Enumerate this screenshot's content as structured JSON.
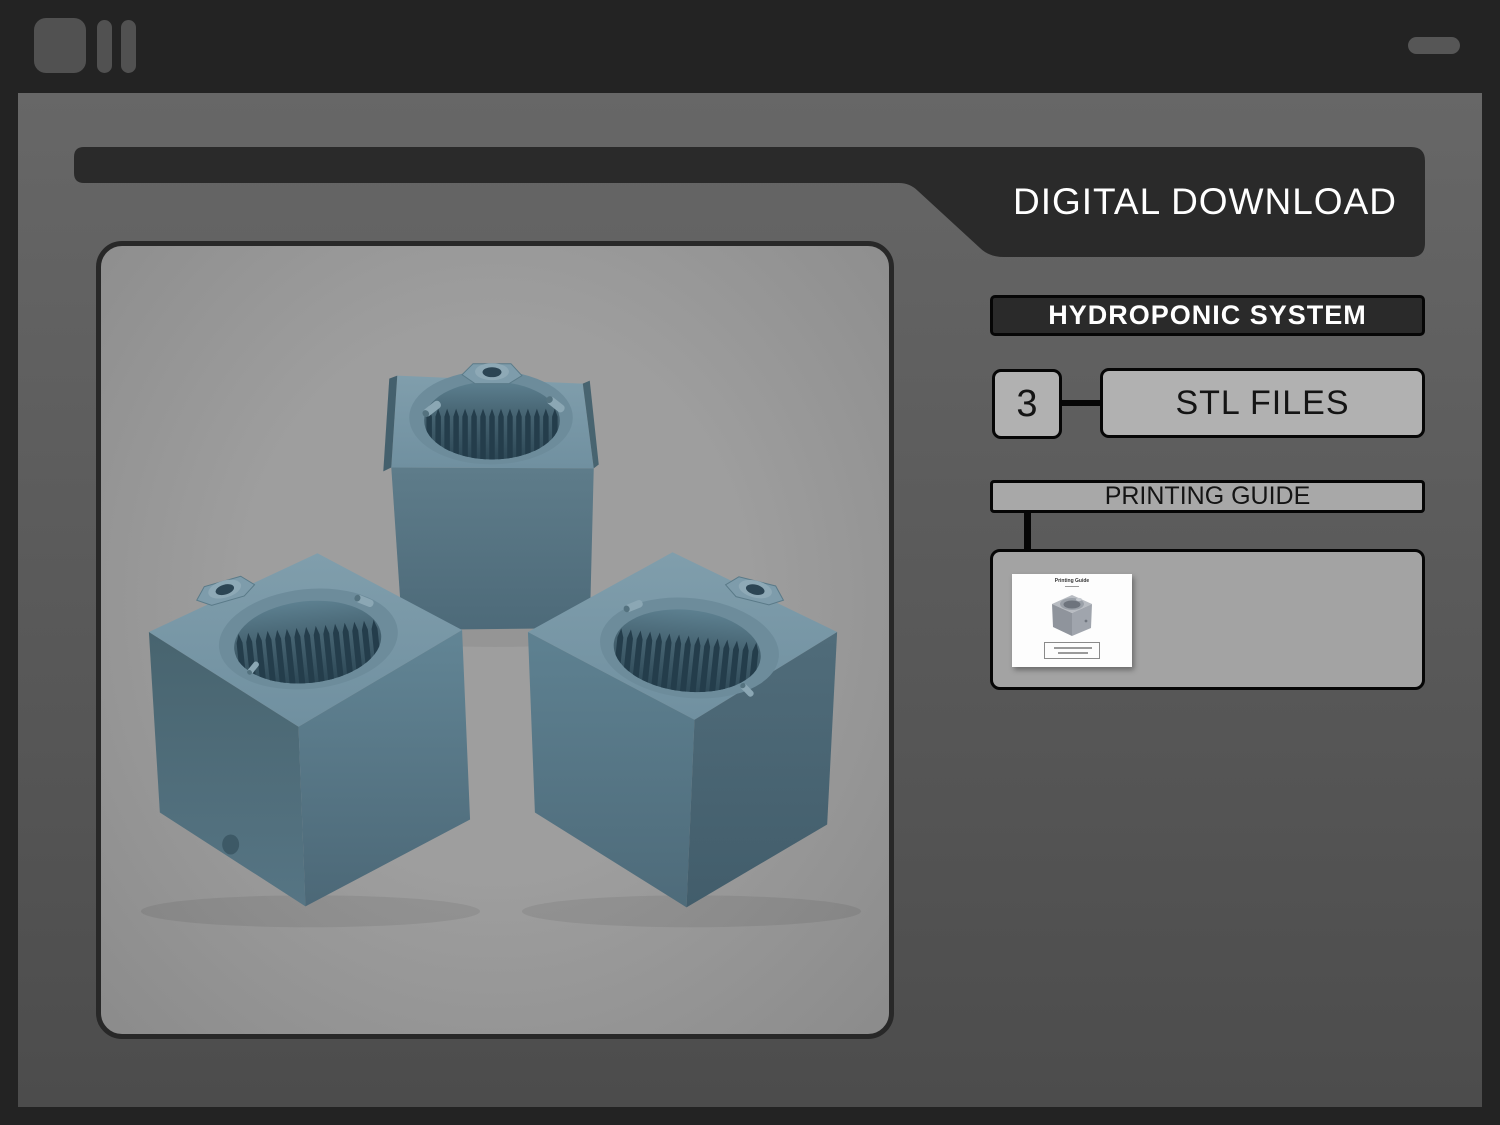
{
  "topbar": {
    "icons": [
      "app-square-icon",
      "app-bar-icon",
      "app-bar-icon",
      "minimize-pill-icon"
    ]
  },
  "header": {
    "title": "DIGITAL DOWNLOAD"
  },
  "product": {
    "title": "HYDROPONIC SYSTEM"
  },
  "files": {
    "count": "3",
    "type_label": "STL FILES"
  },
  "printing_guide": {
    "label": "PRINTING GUIDE",
    "thumbnail": {
      "title": "Printing Guide"
    }
  },
  "image": {
    "description": "3D render of three blue-gray cube hydroponic planters with toothed circular openings and corner spouts",
    "object_count": 3
  },
  "colors": {
    "page_bg": "#232323",
    "panel_top": "#676767",
    "panel_bottom": "#4c4c4c",
    "dark_bar": "#2a2a2a",
    "box_fill": "#b1b1b1",
    "bar_fill": "#a8a8a8",
    "guide_box_fill": "#a3a3a3",
    "image_bg": "#989898",
    "line_black": "#060606",
    "text_light": "#ffffff",
    "text_dark": "#141414",
    "cube_top": "#7b99a8",
    "cube_mid": "#5d7f8f",
    "cube_dark": "#4b6876"
  }
}
